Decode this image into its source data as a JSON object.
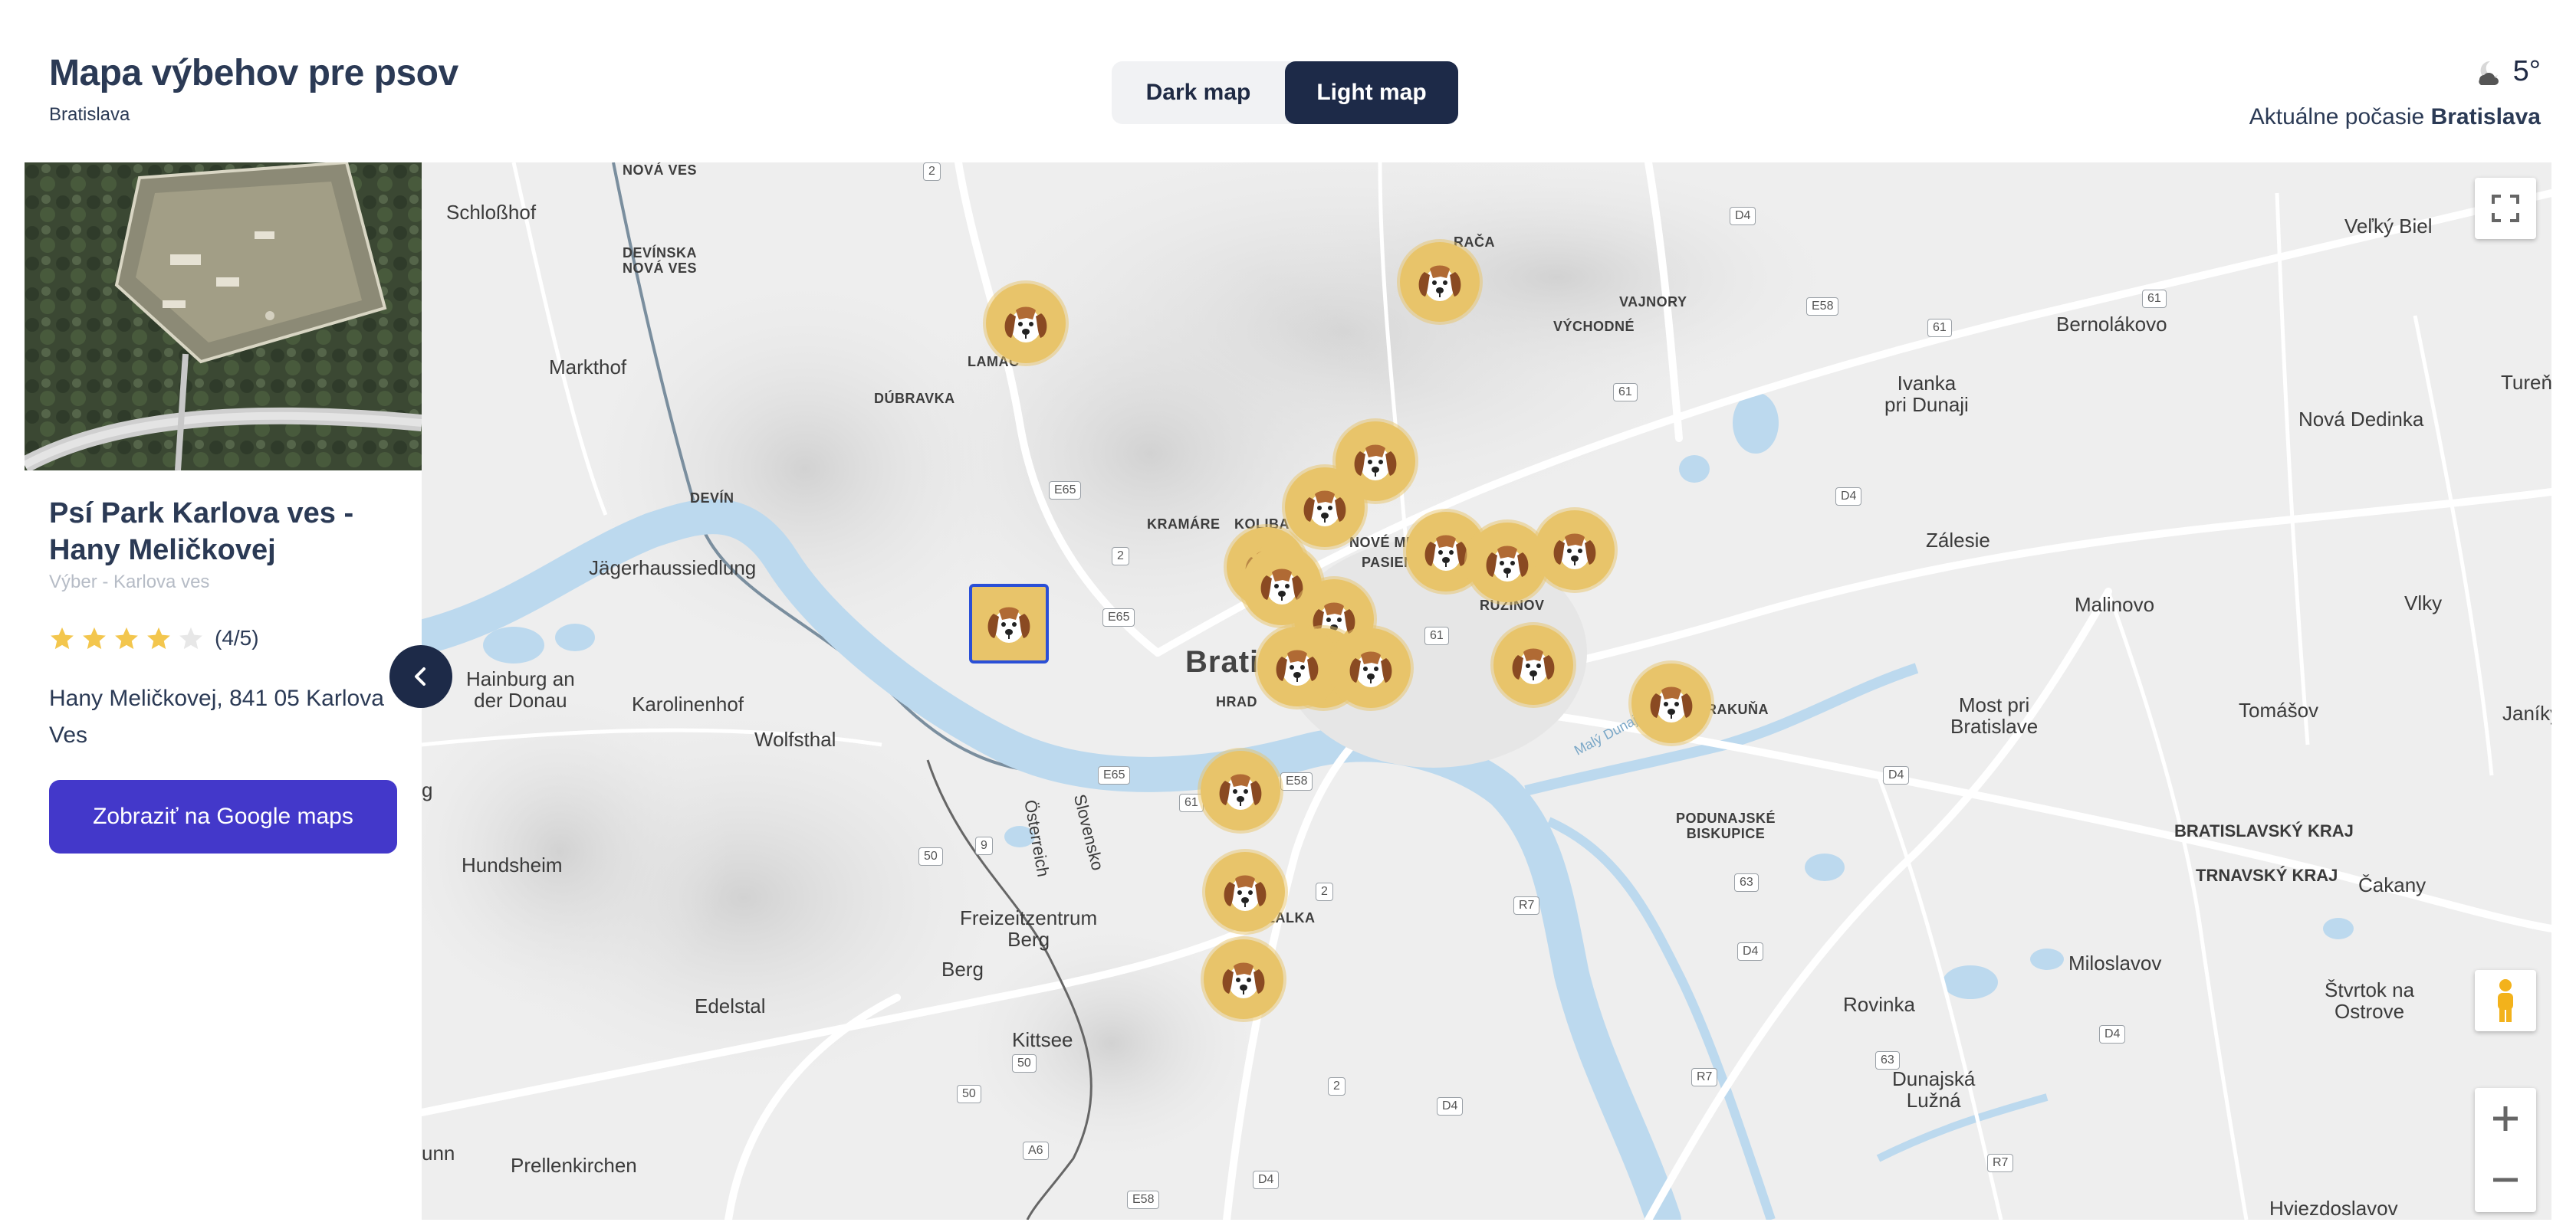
{
  "header": {
    "title": "Mapa výbehov pre psov",
    "subtitle": "Bratislava"
  },
  "map_style_toggle": {
    "options": [
      {
        "label": "Dark map",
        "active": false
      },
      {
        "label": "Light map",
        "active": true
      }
    ]
  },
  "weather": {
    "temperature": "5°",
    "icon": "partly-cloudy-night-icon",
    "caption_prefix": "Aktuálne počasie",
    "city": "Bratislava"
  },
  "park_card": {
    "name": "Psí Park Karlova ves - Hany Meličkovej",
    "area": "Výber - Karlova ves",
    "rating": 4,
    "rating_max": 5,
    "rating_text": "(4/5)",
    "address": "Hany Meličkovej, 841 05 Karlova Ves",
    "button_label": "Zobraziť na Google maps"
  },
  "colors": {
    "accent": "#4338ca",
    "navy": "#1d2a48",
    "marker": "#e8c46a",
    "water": "#bcd9ee"
  },
  "map": {
    "place_labels": {
      "schlosshof": "Schloßhof",
      "devinska": "DEVÍNSKA\nNOVÁ VES",
      "nova_ves_top": "NOVÁ VES",
      "markthof": "Markthof",
      "lamac": "LAMAČ",
      "dubravka": "DÚBRAVKA",
      "devin": "DEVÍN",
      "jagerhaus": "Jägerhaussiedlung",
      "kramare": "KRAMÁRE",
      "koliba": "KOLIBA",
      "nove_mesto": "NOVÉ MESTO",
      "pasienky": "PASIENKY",
      "raca": "RAČA",
      "vajnory": "VAJNORY",
      "vychodne": "VÝCHODNÉ",
      "ruzinov": "RUŽINOV",
      "bratislava": "Brati",
      "hrad": "HRAD",
      "hainburg": "Hainburg an\nder Donau",
      "karolinenhof": "Karolinenhof",
      "wolfsthal": "Wolfsthal",
      "hundsheim": "Hundsheim",
      "freizeit": "Freizeitzentrum\nBerg",
      "berg": "Berg",
      "edelstal": "Edelstal",
      "kittsee": "Kittsee",
      "prellenkirchen": "Prellenkirchen",
      "unn": "unn",
      "g_edge": "g",
      "petrzalka": "ŽALKA",
      "podunajske": "PODUNAJSKÉ\nBISKUPICE",
      "prievoz": "RAKUŇA",
      "velky_biel": "Veľký Biel",
      "bernolakovo": "Bernolákovo",
      "ivanka": "Ivanka\npri Dunaji",
      "turen": "Tureň",
      "nova_dedinka": "Nová Dedinka",
      "zalesie": "Zálesie",
      "malinovo": "Malinovo",
      "vlky": "Vlky",
      "most": "Most pri\nBratislave",
      "tomasov": "Tomášov",
      "janiky": "Janíky",
      "bsk": "BRATISLAVSKÝ KRAJ",
      "tsk": "TRNAVSKÝ KRAJ",
      "cakany": "Čakany",
      "miloslavov": "Miloslavov",
      "rovinka": "Rovinka",
      "stvrtok": "Štvrtok na\nOstrove",
      "dunajska": "Dunajská\nLužná",
      "hviezdoslavov": "Hviezdoslavov",
      "osterreich": "Österreich",
      "slovensko": "Slovensko",
      "mala_dunaj": "Malý Dunaj"
    },
    "road_shields": {
      "r2a": "2",
      "d4a": "D4",
      "e58a": "E58",
      "r61a": "61",
      "r61b": "61",
      "r61c": "61",
      "e65a": "E65",
      "r2b": "2",
      "e65b": "E65",
      "r61d": "61",
      "e58b": "E58",
      "r61e": "61",
      "e65c": "E65",
      "r50a": "50",
      "r9": "9",
      "r2c": "2",
      "r7a": "R7",
      "r63a": "63",
      "d4b": "D4",
      "d4c": "D4",
      "d4d": "D4",
      "r63b": "63",
      "r7b": "R7",
      "r50b": "50",
      "r50c": "50",
      "a6": "A6",
      "e58c": "E58",
      "d4e": "D4",
      "r2d": "2",
      "r7c": "R7",
      "d4f": "D4",
      "d4g": "D4"
    },
    "markers_count": 19
  },
  "controls": {
    "fullscreen": "fullscreen-icon",
    "pegman": "pegman-icon",
    "zoom_in": "plus-icon",
    "zoom_out": "minus-icon",
    "collapse": "chevron-left-icon"
  }
}
